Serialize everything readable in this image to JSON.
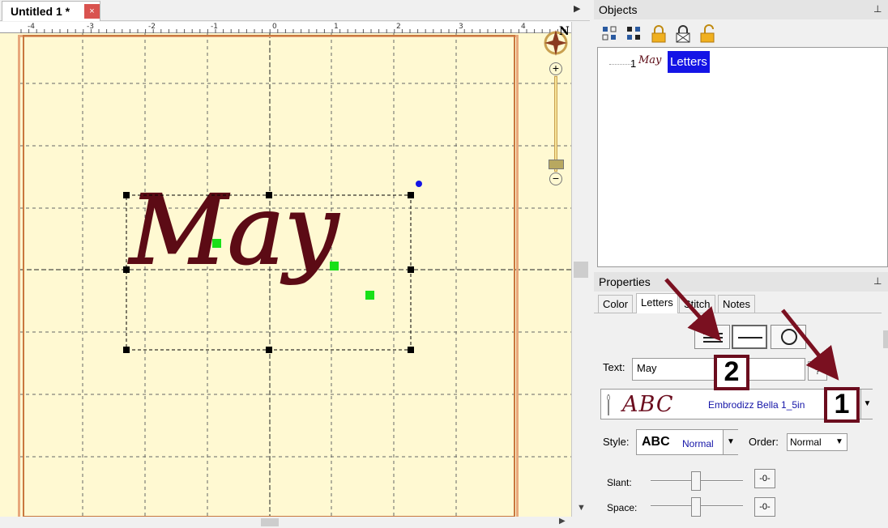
{
  "document_tab": {
    "title": "Untitled 1 *",
    "close_glyph": "×",
    "scroll_glyph": "▶"
  },
  "ruler": {
    "ticks": [
      "-4",
      "-3",
      "-2",
      "-1",
      "0",
      "1",
      "2",
      "3",
      "4"
    ]
  },
  "canvas": {
    "design_text": "May",
    "thread_color": "#5c0b15",
    "background_color": "#fff9d2"
  },
  "navigator": {
    "compass_label": "N",
    "zoom_in_glyph": "+",
    "zoom_out_glyph": "−"
  },
  "objects_panel": {
    "title": "Objects",
    "pin_glyph": "⊥",
    "tree": [
      {
        "number": "1",
        "thumbnail_text": "May",
        "label": "Letters"
      }
    ]
  },
  "properties_panel": {
    "title": "Properties",
    "pin_glyph": "⊥",
    "tabs": [
      {
        "label": "Color",
        "active": false
      },
      {
        "label": "Letters",
        "active": true
      },
      {
        "label": "Stitch",
        "active": false
      },
      {
        "label": "Notes",
        "active": false
      }
    ],
    "text": {
      "label": "Text:",
      "value": "May",
      "help": "?"
    },
    "font": {
      "sample": "ABC",
      "name": "Embrodizz Bella 1_5in",
      "dropdown_glyph": "▼"
    },
    "style": {
      "label": "Style:",
      "sample": "ABC",
      "value": "Normal",
      "dropdown_glyph": "▼"
    },
    "order": {
      "label": "Order:",
      "value": "Normal",
      "dropdown_glyph": "▼"
    },
    "slant": {
      "label": "Slant:",
      "reset": "-0-"
    },
    "space": {
      "label": "Space:",
      "reset": "-0-"
    }
  },
  "annotations": {
    "box1": "1",
    "box2": "2",
    "arrow_color": "#7a1020"
  }
}
